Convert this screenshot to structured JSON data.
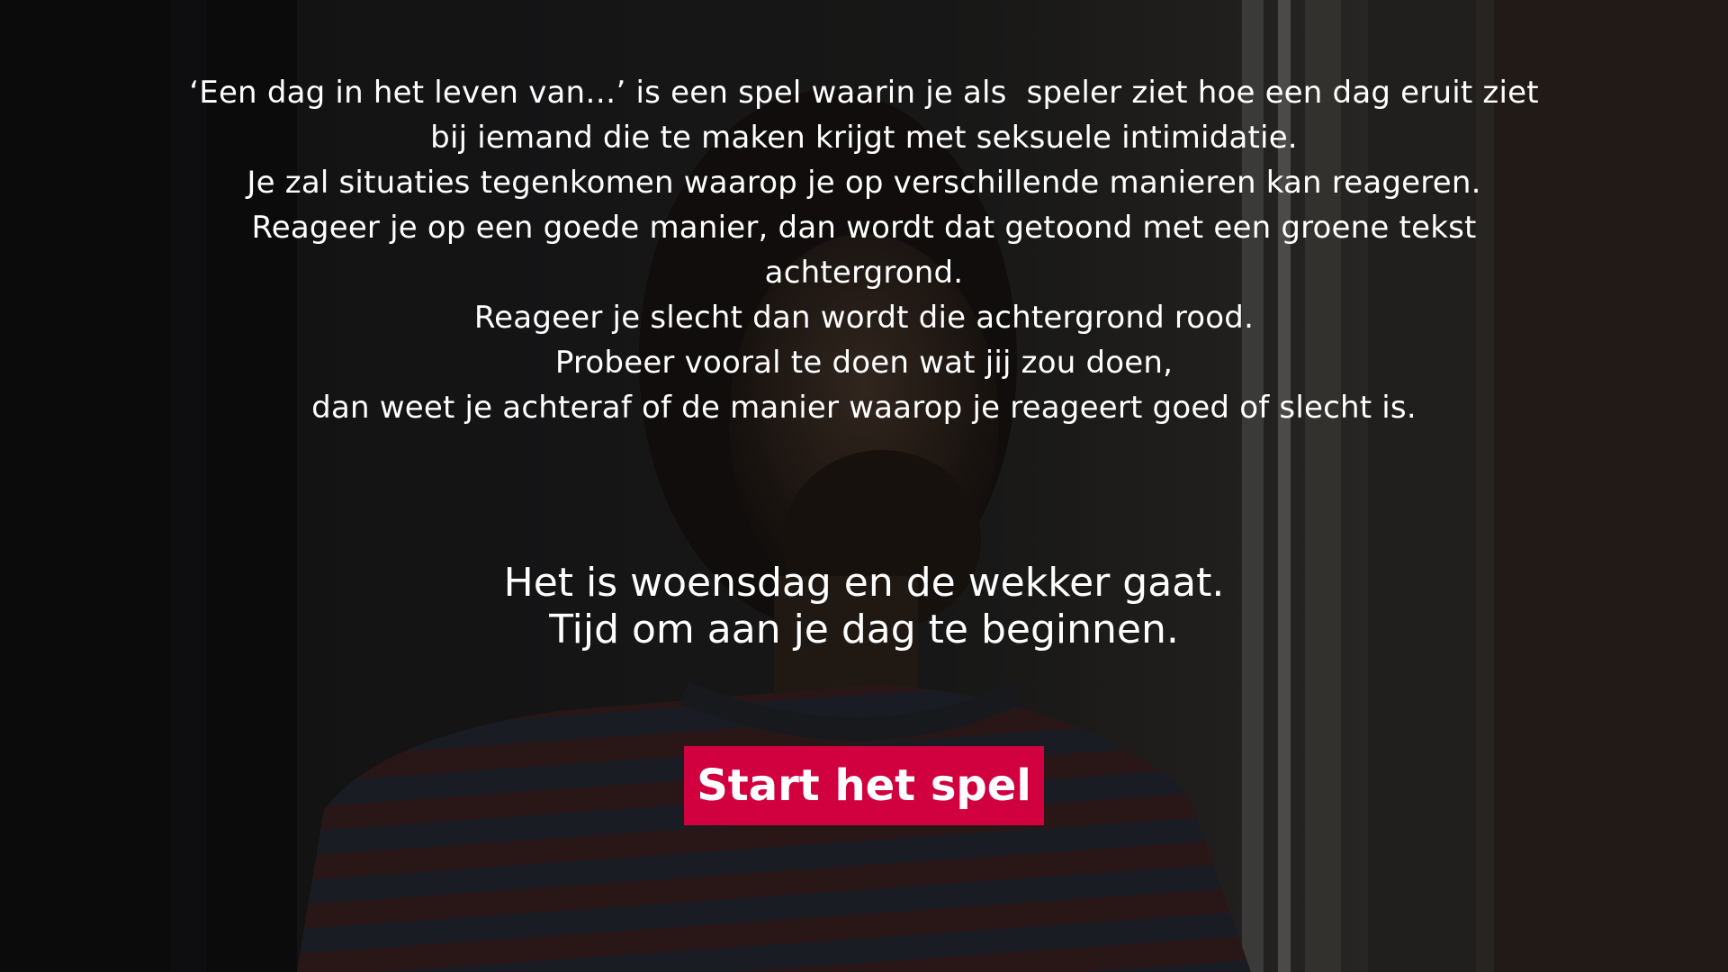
{
  "intro": {
    "lines": [
      "‘Een dag in het leven van…’ is een spel waarin je als  speler ziet hoe een dag eruit ziet",
      "bij iemand die te maken krijgt met seksuele intimidatie.",
      "Je zal situaties tegenkomen waarop je op verschillende manieren kan reageren.",
      "Reageer je op een goede manier, dan wordt dat getoond met een groene tekst",
      "achtergrond.",
      "Reageer je slecht dan wordt die achtergrond rood.",
      "Probeer vooral te doen wat jij zou doen,",
      "dan weet je achteraf of de manier waarop je reageert goed of slecht is."
    ]
  },
  "scene": {
    "lines": [
      "Het is woensdag en de wekker gaat.",
      "Tijd om aan je dag te beginnen."
    ]
  },
  "start_button": {
    "label": "Start het spel"
  },
  "colors": {
    "button": "#d1003f",
    "text": "#ffffff",
    "overlay": "#000000"
  }
}
